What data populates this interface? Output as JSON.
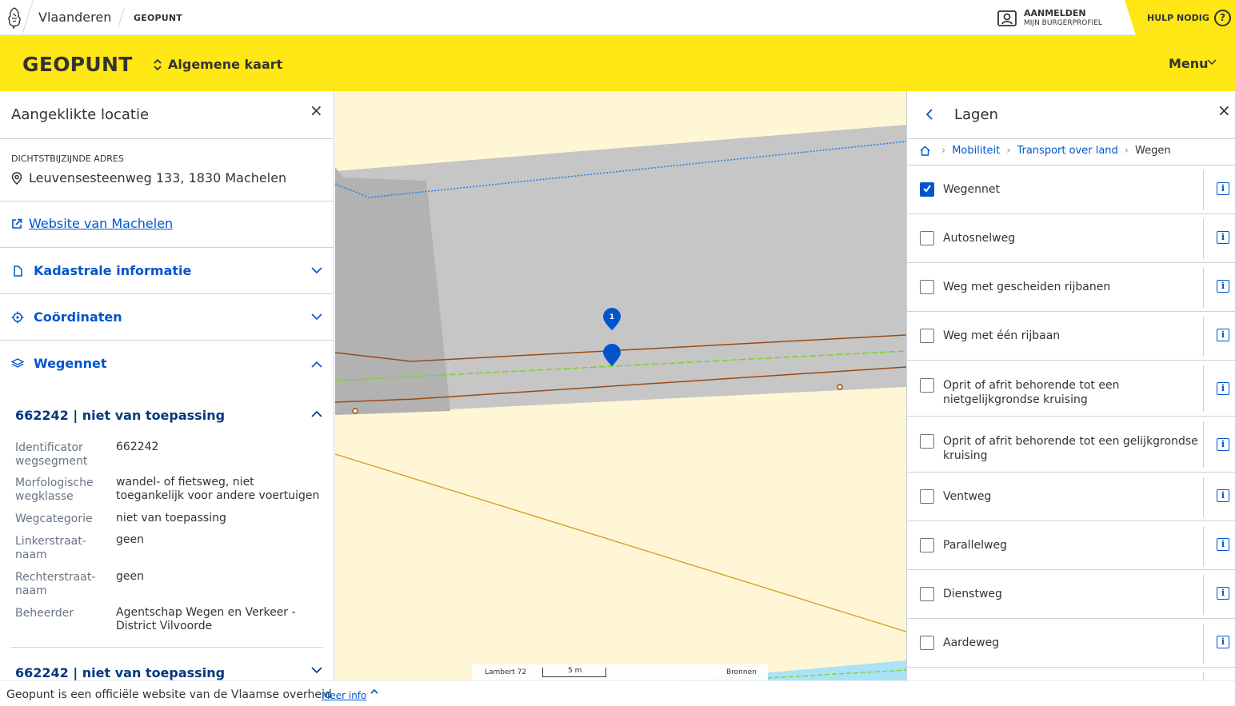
{
  "topbar": {
    "entity": "Vlaanderen",
    "site": "GEOPUNT",
    "login_line1": "AANMELDEN",
    "login_line2": "MIJN BURGERPROFIEL",
    "help": "HULP NODIG",
    "help_icon": "?"
  },
  "header": {
    "brand": "GEOPUNT",
    "map_selector": "Algemene kaart",
    "menu": "Menu"
  },
  "left_panel": {
    "title": "Aangeklikte locatie",
    "close": "×",
    "address_label": "DICHTSTBIJZIJNDE ADRES",
    "address": "Leuvensesteenweg 133, 1830 Machelen",
    "website_link": "Website van Machelen",
    "accordions": [
      {
        "label": "Kadastrale informatie",
        "expanded": false
      },
      {
        "label": "Coördinaten",
        "expanded": false
      },
      {
        "label": "Wegennet",
        "expanded": true
      }
    ],
    "segments": [
      {
        "title": "662242 | niet van toepassing",
        "expanded": true,
        "properties": [
          {
            "key": "Identificator wegsegment",
            "value": "662242"
          },
          {
            "key": "Morfologische wegklasse",
            "value": "wandel- of fietsweg, niet toegankelijk voor andere voertuigen"
          },
          {
            "key": "Wegcategorie",
            "value": "niet van toepassing"
          },
          {
            "key": "Linkerstraat­naam",
            "value": "geen"
          },
          {
            "key": "Rechterstraat­naam",
            "value": "geen"
          },
          {
            "key": "Beheerder",
            "value": "Agentschap Wegen en Verkeer - District Vilvoorde"
          }
        ]
      },
      {
        "title": "662242 | niet van toepassing",
        "expanded": false
      }
    ]
  },
  "map": {
    "marker_label": "1",
    "scale": {
      "projection": "Lambert 72",
      "distance": "5 m",
      "sources": "Bronnen"
    },
    "colors": {
      "background": "#fff6d5",
      "road_fill": "#c6c6c6",
      "road_dark": "#b0b0b0",
      "road_edge": "#9a4a12",
      "bike_line": "#7fd12a",
      "border_dotted": "#2b7de9",
      "diagonal": "#d89a1e",
      "marker": "#0055cc",
      "water": "#a9e3f5"
    }
  },
  "right_panel": {
    "title": "Lagen",
    "close": "×",
    "breadcrumbs": [
      "Mobiliteit",
      "Transport over land"
    ],
    "current": "Wegen",
    "layers": [
      {
        "label": "Wegennet",
        "checked": true
      },
      {
        "label": "Autosnelweg",
        "checked": false
      },
      {
        "label": "Weg met gescheiden rijbanen",
        "checked": false
      },
      {
        "label": "Weg met één rijbaan",
        "checked": false
      },
      {
        "label": "Oprit of afrit behorende tot een nietgelijkgrondse kruising",
        "checked": false
      },
      {
        "label": "Oprit of afrit behorende tot een gelijkgrondse kruising",
        "checked": false
      },
      {
        "label": "Ventweg",
        "checked": false
      },
      {
        "label": "Parallelweg",
        "checked": false
      },
      {
        "label": "Dienstweg",
        "checked": false
      },
      {
        "label": "Aardeweg",
        "checked": false
      }
    ],
    "info_glyph": "i"
  },
  "footer": {
    "text": "Geopunt is een officiële website van de Vlaamse overheid",
    "link": "Meer info"
  }
}
